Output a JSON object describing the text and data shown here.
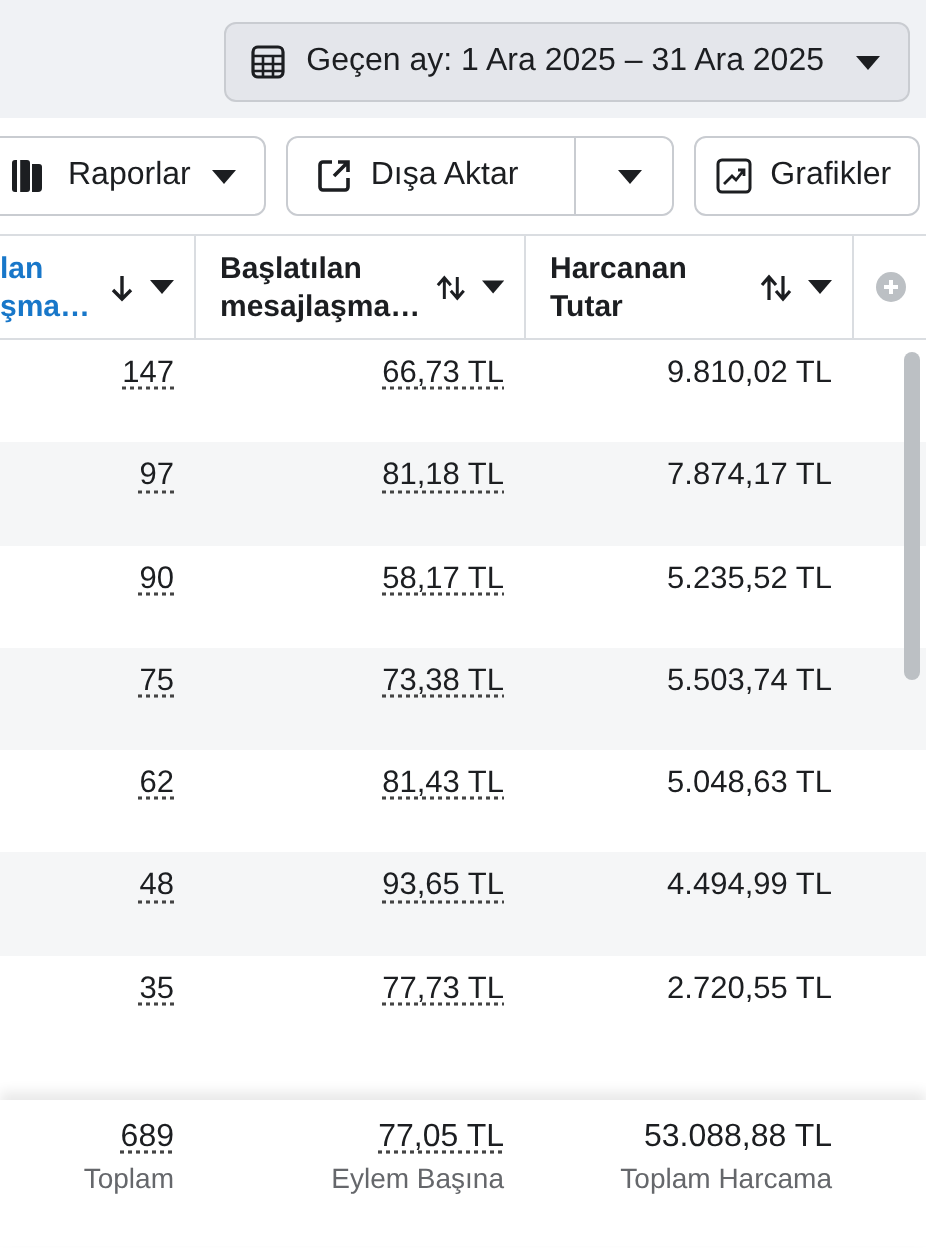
{
  "date_range": {
    "label": "Geçen ay: 1 Ara 2025 – 31 Ara 2025"
  },
  "toolbar": [
    {
      "kind": "menu",
      "label": "Raporlar"
    },
    {
      "kind": "split",
      "label": "Dışa Aktar"
    },
    {
      "kind": "plain",
      "label": "Grafikler"
    }
  ],
  "table": {
    "columns": [
      {
        "label": "lan\nşma…",
        "sorted": true,
        "dotted": true
      },
      {
        "label": "Başlatılan\nmesajlaşma…",
        "sorted": false,
        "dotted": true
      },
      {
        "label": "Harcanan\nTutar",
        "sorted": false,
        "dotted": false
      }
    ],
    "rows": [
      {
        "cells": [
          "147",
          "66,73 TL",
          "9.810,02 TL"
        ]
      },
      {
        "cells": [
          "97",
          "81,18 TL",
          "7.874,17 TL"
        ]
      },
      {
        "cells": [
          "90",
          "58,17 TL",
          "5.235,52 TL"
        ]
      },
      {
        "cells": [
          "75",
          "73,38 TL",
          "5.503,74 TL"
        ]
      },
      {
        "cells": [
          "62",
          "81,43 TL",
          "5.048,63 TL"
        ]
      },
      {
        "cells": [
          "48",
          "93,65 TL",
          "4.494,99 TL"
        ]
      },
      {
        "cells": [
          "35",
          "77,73 TL",
          "2.720,55 TL"
        ]
      }
    ],
    "totals": [
      {
        "value": "689",
        "label": "Toplam"
      },
      {
        "value": "77,05 TL",
        "label": "Eylem Başına"
      },
      {
        "value": "53.088,88 TL",
        "label": "Toplam Harcama"
      }
    ]
  }
}
